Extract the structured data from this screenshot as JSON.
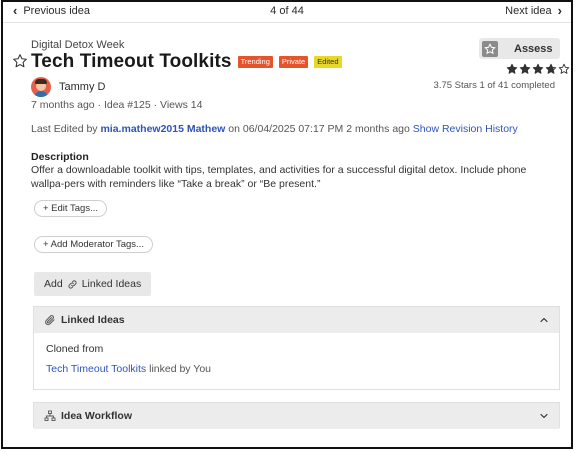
{
  "nav": {
    "prev_label": "Previous idea",
    "counter": "4 of 44",
    "next_label": "Next idea"
  },
  "idea": {
    "category": "Digital Detox Week",
    "title": "Tech Timeout Toolkits",
    "tags": [
      "Trending",
      "Private",
      "Edited"
    ],
    "author": "Tammy D",
    "meta": "7 months ago  · Idea #125  · Views 14"
  },
  "assess": {
    "button_label": "Assess",
    "rating": 3.75,
    "rating_text": "3.75 Stars 1 of 41 completed"
  },
  "edited": {
    "prefix": "Last Edited by",
    "user": "mia.mathew2015 Mathew",
    "suffix": "on 06/04/2025 07:17 PM 2 months ago",
    "history_link": "Show Revision History"
  },
  "description": {
    "heading": "Description",
    "text": "Offer a downloadable toolkit with tips, templates, and activities for a successful digital detox. Include phone wallpa-pers with reminders like “Take a break” or “Be present.”"
  },
  "actions": {
    "edit_tags": "+ Edit Tags...",
    "add_moderator_tags": "+ Add Moderator Tags...",
    "add_linked_pre": "Add",
    "add_linked_post": "Linked Ideas"
  },
  "linked_panel": {
    "title": "Linked Ideas",
    "cloned_from": "Cloned from",
    "linked_idea": "Tech Timeout Toolkits",
    "linked_by": "linked by You"
  },
  "workflow_panel": {
    "title": "Idea Workflow"
  },
  "colors": {
    "link": "#2d55b8",
    "tag_trending": "#e5542a",
    "tag_private": "#e5542a",
    "tag_edited": "#e8d629"
  }
}
